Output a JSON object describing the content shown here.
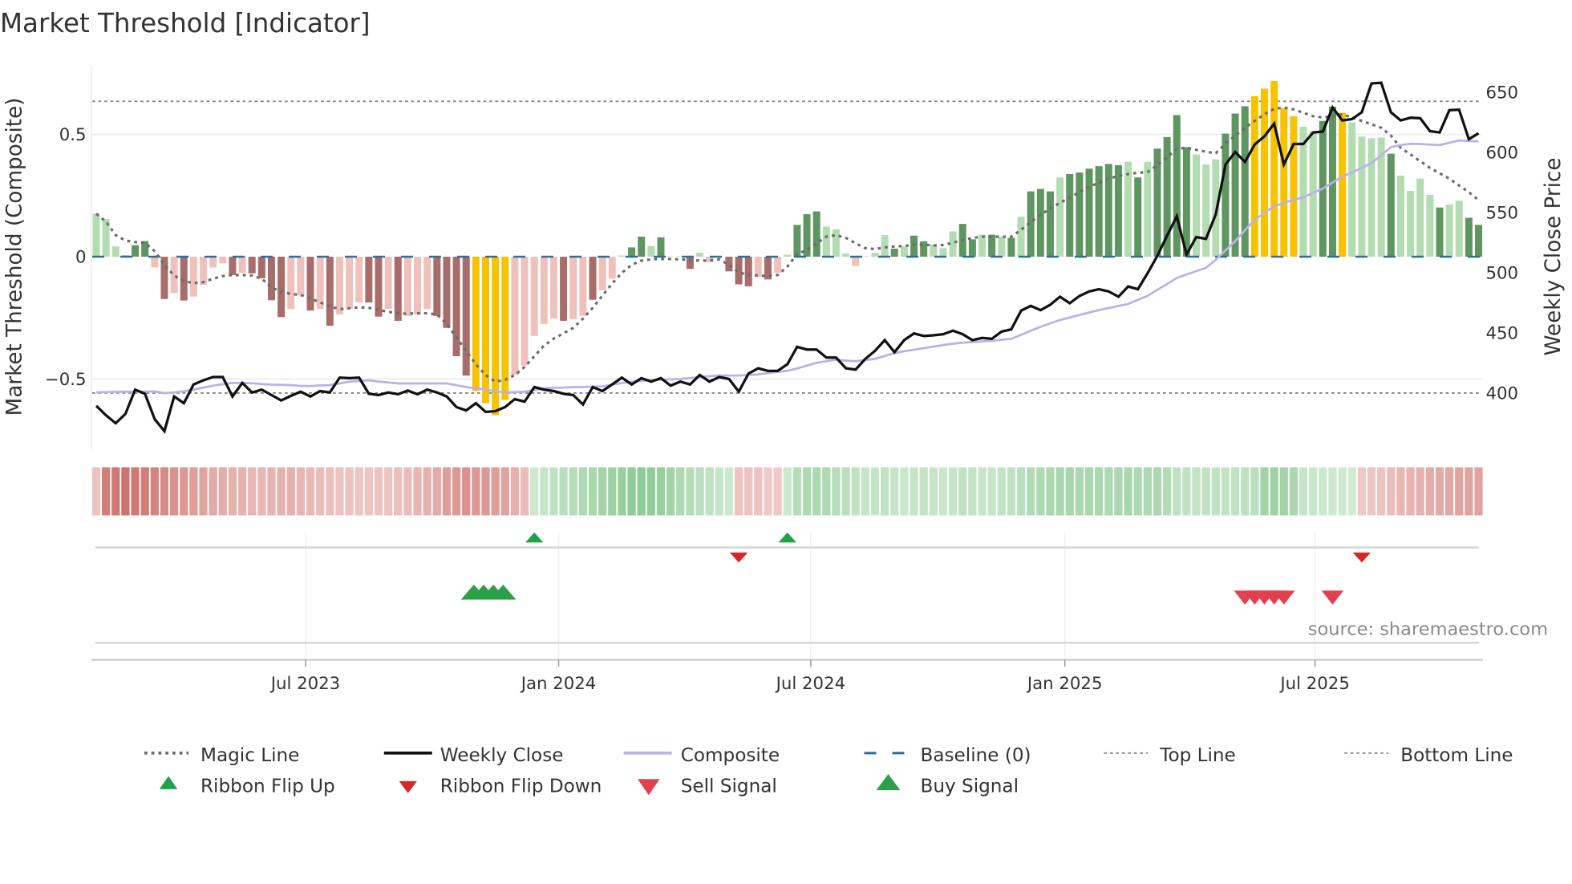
{
  "title": "Market Threshold [Indicator]",
  "source": "source: sharemaestro.com",
  "colors": {
    "dark_green": "#5f9560",
    "light_green": "#b3dcb1",
    "dark_red": "#a66d6b",
    "light_red": "#efc1bc",
    "yellow": "#f7c300",
    "magic_line": "#6b6b6b",
    "weekly_close": "#111111",
    "composite": "#bab1ea",
    "baseline": "#2e6f9e",
    "threshold_lines": "#888888",
    "ribbon_flip_up": "#1ea24a",
    "ribbon_flip_down": "#d62728",
    "sell_signal": "#e23f4f",
    "buy_signal": "#2ca048"
  },
  "legend": {
    "magic_line": "Magic Line",
    "weekly_close": "Weekly Close",
    "composite": "Composite",
    "baseline": "Baseline (0)",
    "top_line": "Top Line",
    "bottom_line": "Bottom Line",
    "ribbon_flip_up": "Ribbon Flip Up",
    "ribbon_flip_down": "Ribbon Flip Down",
    "sell_signal": "Sell Signal",
    "buy_signal": "Buy Signal"
  },
  "chart_data": {
    "type": "bar",
    "title": "Market Threshold [Indicator]",
    "x_frequency": "weekly",
    "x_count": 143,
    "x_ticks": [
      {
        "label": "Jul 2023",
        "week_index": 21.5
      },
      {
        "label": "Jan 2024",
        "week_index": 47.5
      },
      {
        "label": "Jul 2024",
        "week_index": 73.4
      },
      {
        "label": "Jan 2025",
        "week_index": 99.5
      },
      {
        "label": "Jul 2025",
        "week_index": 125.2
      }
    ],
    "left_axis": {
      "label": "Market Threshold (Composite)",
      "ylim": [
        -0.79,
        0.78
      ],
      "ticks": [
        {
          "label": "0.5",
          "value": 0.5
        },
        {
          "label": "0",
          "value": 0
        },
        {
          "label": "−0.5",
          "value": -0.5
        }
      ]
    },
    "right_axis": {
      "label": "Weekly Close Price",
      "ylim": [
        353,
        672
      ],
      "ticks": [
        {
          "label": "650",
          "value": 650
        },
        {
          "label": "600",
          "value": 600
        },
        {
          "label": "550",
          "value": 550
        },
        {
          "label": "500",
          "value": 500
        },
        {
          "label": "450",
          "value": 450
        },
        {
          "label": "400",
          "value": 400
        }
      ]
    },
    "top_line": 0.635,
    "bottom_line": -0.557,
    "baseline": 0,
    "legend_position": "bottom",
    "composite_histogram": {
      "values": [
        0.176,
        0.154,
        0.042,
        0.005,
        0.047,
        0.064,
        -0.044,
        -0.173,
        -0.148,
        -0.179,
        -0.163,
        -0.115,
        -0.044,
        -0.027,
        -0.075,
        -0.066,
        -0.068,
        -0.088,
        -0.178,
        -0.247,
        -0.214,
        -0.159,
        -0.22,
        -0.214,
        -0.282,
        -0.236,
        -0.214,
        -0.187,
        -0.187,
        -0.245,
        -0.214,
        -0.262,
        -0.242,
        -0.236,
        -0.214,
        -0.242,
        -0.291,
        -0.407,
        -0.486,
        -0.549,
        -0.599,
        -0.648,
        -0.585,
        -0.484,
        -0.445,
        -0.324,
        -0.275,
        -0.253,
        -0.262,
        -0.255,
        -0.242,
        -0.176,
        -0.137,
        -0.09,
        0.005,
        0.038,
        0.082,
        0.044,
        0.079,
        0.002,
        0.002,
        -0.05,
        0.016,
        -0.022,
        0.002,
        -0.06,
        -0.113,
        -0.121,
        -0.082,
        -0.093,
        -0.066,
        0.008,
        0.13,
        0.174,
        0.185,
        0.123,
        0.112,
        0.013,
        -0.038,
        0.002,
        0.016,
        0.088,
        0.033,
        0.042,
        0.086,
        0.063,
        0.049,
        0.035,
        0.104,
        0.134,
        0.071,
        0.09,
        0.09,
        0.082,
        0.077,
        0.163,
        0.267,
        0.277,
        0.267,
        0.324,
        0.338,
        0.344,
        0.36,
        0.37,
        0.379,
        0.374,
        0.388,
        0.324,
        0.388,
        0.442,
        0.489,
        0.579,
        0.448,
        0.418,
        0.377,
        0.398,
        0.503,
        0.585,
        0.615,
        0.656,
        0.687,
        0.718,
        0.607,
        0.574,
        0.531,
        0.514,
        0.555,
        0.613,
        0.588,
        0.549,
        0.491,
        0.484,
        0.487,
        0.421,
        0.332,
        0.269,
        0.319,
        0.253,
        0.201,
        0.214,
        0.229,
        0.159,
        0.13
      ],
      "color_codes": "gggGGGrRrRrrrrRrRRRRrrRrRrrrRRrRrrrRRRRYYYYrrrrrRrrRrrgGGgGggRgrgRRRrRrgGGGgggrgggGgGGgggGGgGgGgGGGgGGGGGGgGgGGGGgggGGGYYYYYggGGYggggGggggGggGGgg",
      "color_legend": {
        "G": "dark_green",
        "g": "light_green",
        "R": "dark_red",
        "r": "light_red",
        "Y": "yellow"
      }
    },
    "magic_line": [
      0.176,
      0.143,
      0.088,
      0.066,
      0.06,
      0.057,
      0.022,
      -0.033,
      -0.077,
      -0.099,
      -0.108,
      -0.104,
      -0.09,
      -0.079,
      -0.075,
      -0.075,
      -0.077,
      -0.09,
      -0.126,
      -0.143,
      -0.152,
      -0.156,
      -0.17,
      -0.187,
      -0.203,
      -0.214,
      -0.211,
      -0.207,
      -0.209,
      -0.218,
      -0.225,
      -0.231,
      -0.233,
      -0.231,
      -0.231,
      -0.236,
      -0.275,
      -0.33,
      -0.385,
      -0.44,
      -0.484,
      -0.511,
      -0.503,
      -0.484,
      -0.451,
      -0.407,
      -0.363,
      -0.335,
      -0.313,
      -0.291,
      -0.253,
      -0.209,
      -0.159,
      -0.11,
      -0.066,
      -0.033,
      -0.016,
      -0.011,
      -0.009,
      -0.009,
      -0.011,
      -0.013,
      -0.016,
      -0.016,
      -0.011,
      -0.033,
      -0.064,
      -0.075,
      -0.077,
      -0.079,
      -0.075,
      -0.04,
      0.011,
      0.027,
      0.055,
      0.082,
      0.088,
      0.077,
      0.055,
      0.035,
      0.031,
      0.038,
      0.042,
      0.044,
      0.049,
      0.049,
      0.046,
      0.048,
      0.057,
      0.068,
      0.077,
      0.082,
      0.082,
      0.082,
      0.082,
      0.11,
      0.143,
      0.17,
      0.198,
      0.22,
      0.242,
      0.264,
      0.286,
      0.302,
      0.319,
      0.33,
      0.338,
      0.343,
      0.346,
      0.374,
      0.407,
      0.44,
      0.445,
      0.437,
      0.429,
      0.423,
      0.462,
      0.495,
      0.527,
      0.555,
      0.582,
      0.604,
      0.61,
      0.602,
      0.588,
      0.574,
      0.569,
      0.574,
      0.582,
      0.569,
      0.555,
      0.541,
      0.527,
      0.495,
      0.445,
      0.418,
      0.39,
      0.363,
      0.341,
      0.319,
      0.291,
      0.264,
      0.231
    ],
    "weekly_close": [
      389.4,
      381.6,
      374.9,
      382.7,
      402.8,
      399.4,
      378.3,
      368.3,
      397.2,
      391.6,
      407.2,
      410.6,
      413.3,
      413.3,
      397.2,
      408.4,
      400.5,
      402.8,
      398.3,
      393.9,
      397.7,
      401.2,
      397.2,
      401.7,
      400.5,
      412.8,
      412.4,
      412.8,
      399.4,
      398.3,
      400.5,
      399.0,
      402.1,
      399.0,
      402.8,
      400.5,
      397.2,
      388.3,
      385.6,
      391.6,
      384.3,
      385.0,
      388.3,
      395.0,
      392.8,
      405.0,
      402.8,
      401.7,
      399.4,
      398.3,
      390.5,
      405.0,
      401.7,
      407.2,
      412.8,
      407.2,
      412.4,
      409.5,
      412.4,
      406.2,
      409.5,
      407.2,
      415.0,
      409.5,
      413.3,
      411.7,
      401.2,
      416.2,
      420.6,
      418.4,
      418.4,
      424.0,
      438.4,
      436.2,
      436.2,
      429.5,
      429.5,
      420.6,
      419.5,
      428.4,
      435.1,
      444.0,
      434.0,
      444.0,
      449.6,
      447.4,
      448.0,
      448.9,
      451.8,
      448.9,
      444.0,
      445.8,
      445.1,
      451.1,
      452.9,
      468.5,
      472.5,
      468.9,
      473.4,
      480.1,
      474.7,
      480.7,
      484.5,
      486.3,
      484.5,
      480.1,
      488.6,
      486.3,
      499.7,
      514.1,
      530.8,
      546.9,
      515.2,
      529.7,
      528.2,
      548.7,
      589.9,
      600.3,
      592.1,
      606.6,
      613.3,
      623.9,
      589.9,
      607.0,
      607.0,
      616.6,
      617.3,
      637.3,
      626.6,
      627.7,
      633.3,
      657.3,
      657.8,
      633.3,
      626.6,
      628.8,
      628.4,
      617.7,
      616.6,
      635.1,
      635.5,
      611.0,
      615.9
    ],
    "composite": [
      400.5,
      400.8,
      401,
      401.2,
      401.2,
      401.2,
      401.4,
      399.9,
      400.5,
      401.5,
      402.8,
      404.5,
      406.2,
      407.3,
      408.4,
      408.4,
      408.2,
      407.5,
      407,
      406.8,
      406.6,
      406,
      405.8,
      406.3,
      406.6,
      408,
      409.5,
      410,
      410.6,
      409.5,
      408.8,
      408,
      408,
      408,
      408,
      408,
      408,
      406.5,
      405,
      404,
      402.8,
      401.6,
      400.5,
      400.8,
      401.2,
      402.5,
      403.9,
      404.5,
      404.6,
      405,
      405,
      405.3,
      405.6,
      407,
      408.4,
      409.3,
      410.2,
      410.8,
      411,
      411.4,
      411.7,
      412.5,
      413.3,
      414,
      414.6,
      414.6,
      414.6,
      415,
      415.5,
      416.6,
      417.7,
      418.4,
      420.5,
      422.8,
      425.1,
      426.4,
      427.7,
      427,
      426.5,
      427.5,
      428.4,
      430.8,
      433.2,
      434.8,
      436,
      437.3,
      438.6,
      439.9,
      441,
      441.8,
      442.4,
      443,
      443.5,
      444.3,
      445.1,
      448.4,
      451.8,
      455.1,
      457.9,
      460.7,
      462.8,
      464.9,
      467,
      469,
      470.7,
      472.4,
      474.1,
      477.5,
      480.8,
      485.8,
      490.7,
      495.7,
      498.5,
      501.3,
      504.1,
      510.8,
      518.6,
      526.4,
      535.3,
      544.2,
      549.7,
      555.3,
      558,
      560.7,
      562.6,
      566.4,
      570,
      575,
      579.8,
      583.5,
      587.2,
      591,
      597.7,
      604.3,
      606.1,
      607.2,
      607,
      606.5,
      606.1,
      608,
      609.9,
      609.5,
      609.2
    ],
    "ribbon": [
      -0.2,
      -0.75,
      -0.8,
      -0.85,
      -0.8,
      -0.75,
      -0.7,
      -0.65,
      -0.6,
      -0.55,
      -0.5,
      -0.45,
      -0.4,
      -0.38,
      -0.35,
      -0.33,
      -0.3,
      -0.3,
      -0.32,
      -0.35,
      -0.35,
      -0.3,
      -0.28,
      -0.25,
      -0.22,
      -0.2,
      -0.2,
      -0.18,
      -0.18,
      -0.2,
      -0.2,
      -0.22,
      -0.25,
      -0.3,
      -0.35,
      -0.4,
      -0.5,
      -0.55,
      -0.6,
      -0.55,
      -0.55,
      -0.5,
      -0.45,
      -0.35,
      -0.25,
      0.2,
      0.25,
      0.3,
      0.35,
      0.4,
      0.45,
      0.5,
      0.55,
      0.6,
      0.65,
      0.7,
      0.72,
      0.7,
      0.65,
      0.55,
      0.45,
      0.4,
      0.35,
      0.3,
      0.25,
      0.2,
      -0.2,
      -0.2,
      -0.2,
      -0.15,
      -0.15,
      0.2,
      0.4,
      0.45,
      0.45,
      0.45,
      0.4,
      0.35,
      0.3,
      0.25,
      0.25,
      0.3,
      0.25,
      0.22,
      0.25,
      0.28,
      0.25,
      0.22,
      0.25,
      0.3,
      0.28,
      0.25,
      0.25,
      0.28,
      0.3,
      0.35,
      0.42,
      0.45,
      0.48,
      0.5,
      0.5,
      0.48,
      0.5,
      0.48,
      0.45,
      0.48,
      0.5,
      0.45,
      0.45,
      0.48,
      0.42,
      0.3,
      0.3,
      0.28,
      0.3,
      0.3,
      0.28,
      0.3,
      0.32,
      0.35,
      0.55,
      0.58,
      0.55,
      0.5,
      0.25,
      0.22,
      0.2,
      0.2,
      0.18,
      0.15,
      -0.15,
      -0.18,
      -0.2,
      -0.25,
      -0.3,
      -0.32,
      -0.35,
      -0.38,
      -0.4,
      -0.42,
      -0.45,
      -0.45,
      -0.45
    ],
    "signals": {
      "ribbon_flip_up": [
        45,
        71
      ],
      "ribbon_flip_down": [
        66,
        130
      ],
      "buy_signal": [
        39,
        40,
        41,
        42
      ],
      "sell_signal": [
        118,
        119,
        120,
        121,
        122,
        127
      ]
    }
  }
}
